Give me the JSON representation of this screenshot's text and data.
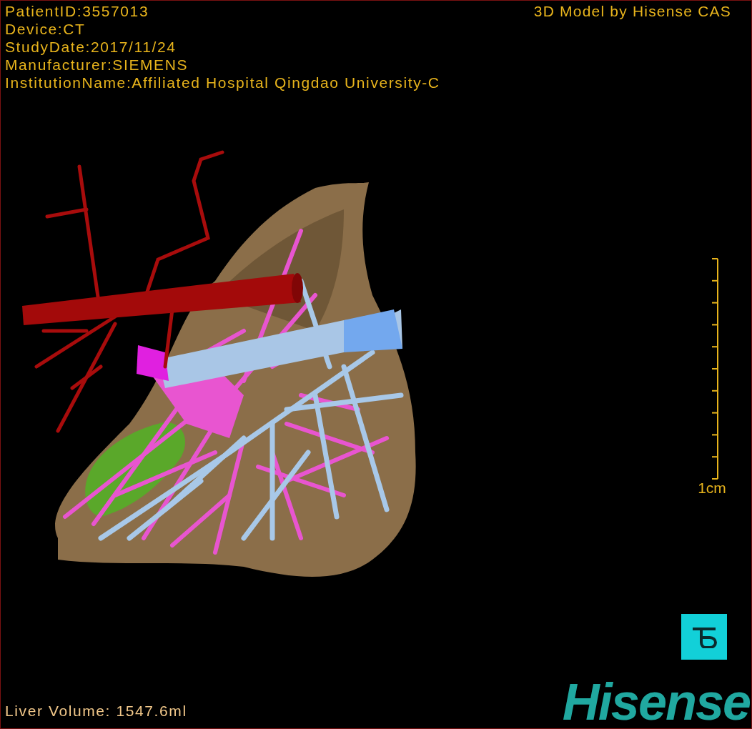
{
  "header": {
    "info": [
      "PatientID:3557013",
      "Device:CT",
      "StudyDate:2017/11/24",
      "Manufacturer:SIEMENS",
      "InstitutionName:Affiliated Hospital Qingdao University-C"
    ],
    "title": "3D Model by Hisense CAS"
  },
  "scale_bar": {
    "label": "1cm"
  },
  "footer": {
    "volume": "Liver Volume: 1547.6ml",
    "logo": "Hisense"
  }
}
